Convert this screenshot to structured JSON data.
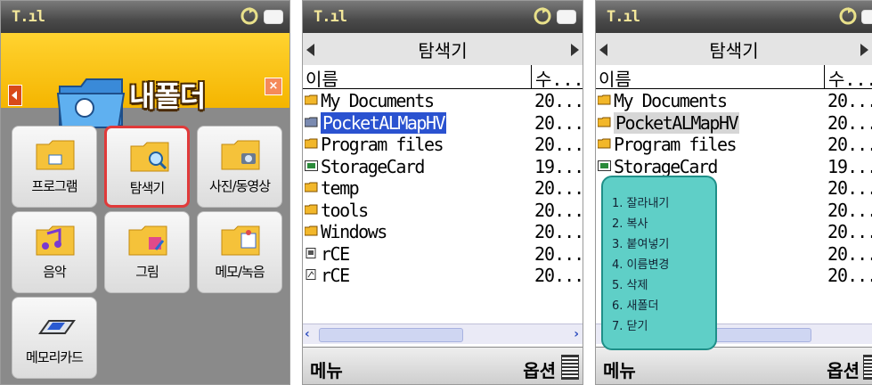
{
  "screen1": {
    "folder_title": "내폴더",
    "tiles": [
      {
        "label": "프로그램",
        "icon": "program-icon"
      },
      {
        "label": "탐색기",
        "icon": "magnifier-icon",
        "selected": true
      },
      {
        "label": "사진/동영상",
        "icon": "camera-icon"
      },
      {
        "label": "음악",
        "icon": "music-icon"
      },
      {
        "label": "그림",
        "icon": "picture-icon"
      },
      {
        "label": "메모/녹음",
        "icon": "memo-icon"
      },
      {
        "label": "메모리카드",
        "icon": "memory-card-icon"
      }
    ]
  },
  "explorer": {
    "title": "탐색기",
    "col_name": "이름",
    "col_size": "수...",
    "files": [
      {
        "name": "My Documents",
        "size": "20...",
        "icon": "folder-icon"
      },
      {
        "name": "PocketALMapHV",
        "size": "20...",
        "icon": "folder-icon"
      },
      {
        "name": "Program files",
        "size": "20...",
        "icon": "folder-icon"
      },
      {
        "name": "StorageCard",
        "size": "19...",
        "icon": "storage-card-icon"
      },
      {
        "name": "temp",
        "size": "20...",
        "icon": "folder-icon"
      },
      {
        "name": "tools",
        "size": "20...",
        "icon": "folder-icon"
      },
      {
        "name": "Windows",
        "size": "20...",
        "icon": "folder-icon"
      },
      {
        "name": "rCE",
        "size": "20...",
        "icon": "file-icon"
      },
      {
        "name": "rCE",
        "size": "20...",
        "icon": "file-icon"
      }
    ],
    "softkey_left": "메뉴",
    "softkey_right": "옵션",
    "softkey_right_clipped": "옵션"
  },
  "context_menu": {
    "items": [
      "1. 잘라내기",
      "2. 복사",
      "3. 붙여넣기",
      "4. 이름변경",
      "5. 삭제",
      "6. 새폴더",
      "7. 닫기"
    ]
  },
  "colors": {
    "title_yellow": "#f5b500",
    "selection_blue": "#2a52d0",
    "menu_teal": "#5fcfc7",
    "tile_border_selected": "#e03a3a"
  }
}
